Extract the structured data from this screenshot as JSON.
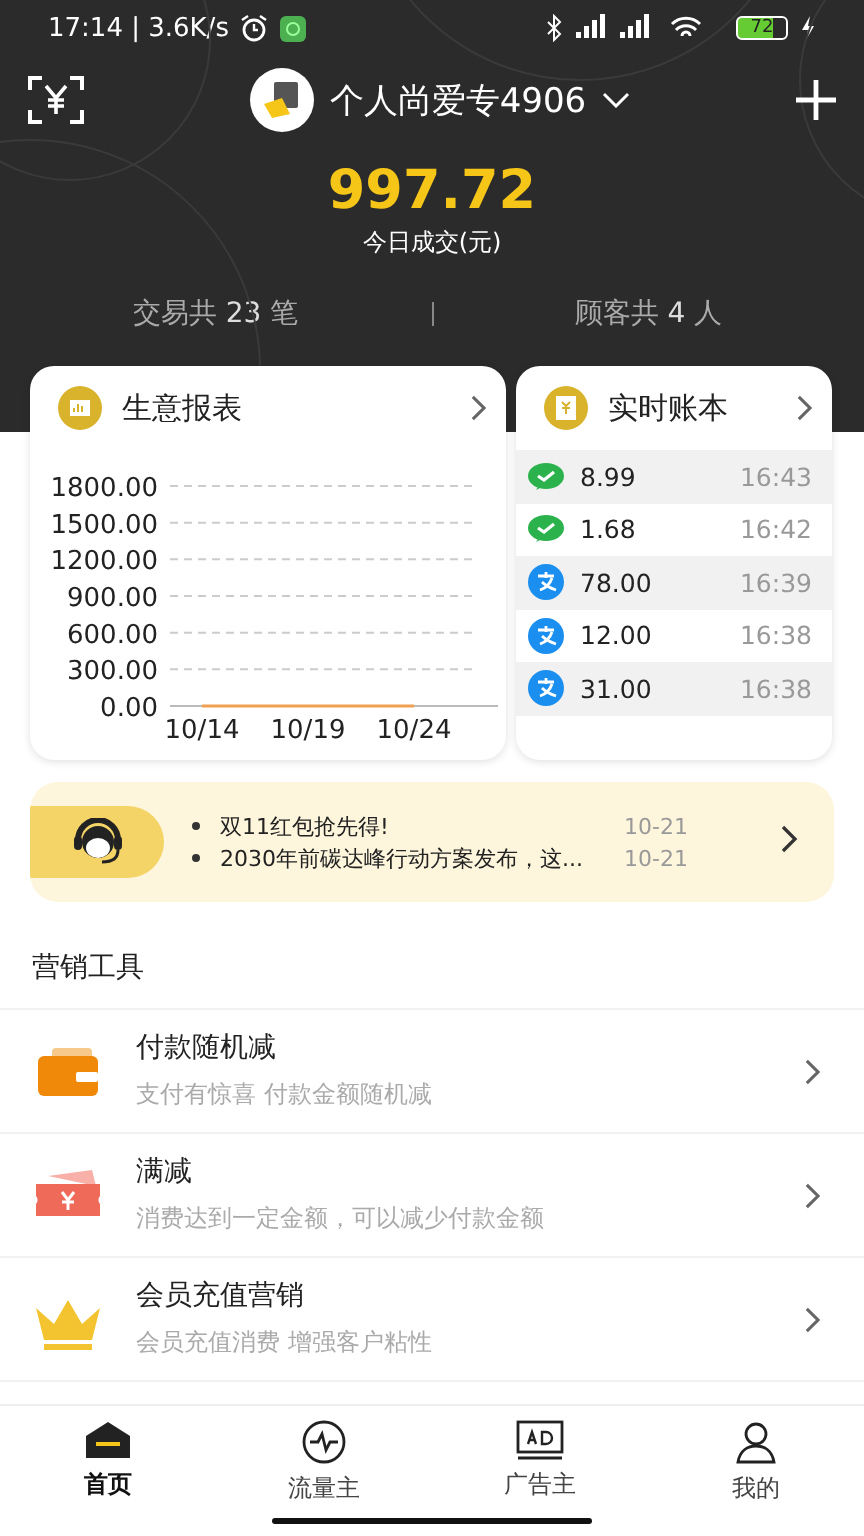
{
  "status_bar": {
    "time": "17:14 | 3.6K/s",
    "battery": "72"
  },
  "header": {
    "store_name": "个人尚爱专4906",
    "amount": "997.72",
    "amount_label": "今日成交(元)",
    "stats": [
      {
        "label": "交易共",
        "value": "23",
        "unit": "笔"
      },
      {
        "label": "顾客共",
        "value": "4",
        "unit": "人"
      }
    ]
  },
  "report_card": {
    "title": "生意报表",
    "chart_data": {
      "type": "line",
      "categories": [
        "10/14",
        "10/19",
        "10/24"
      ],
      "series": [
        {
          "color": "#f0a050",
          "values": [
            0,
            0,
            0
          ]
        }
      ],
      "ylim": [
        0,
        1800
      ],
      "grid": true,
      "yticks": [
        {
          "value": 0,
          "label": "0.00"
        },
        {
          "value": 300,
          "label": "300.00"
        },
        {
          "value": 600,
          "label": "600.00"
        },
        {
          "value": 900,
          "label": "900.00"
        },
        {
          "value": 1200,
          "label": "1200.00"
        },
        {
          "value": 1500,
          "label": "1500.00"
        },
        {
          "value": 1800,
          "label": "1800.00"
        }
      ]
    }
  },
  "ledger_card": {
    "title": "实时账本",
    "entries": [
      {
        "kind": "wechat",
        "amount": "8.99",
        "time": "16:43"
      },
      {
        "kind": "wechat",
        "amount": "1.68",
        "time": "16:42"
      },
      {
        "kind": "alipay",
        "amount": "78.00",
        "time": "16:39"
      },
      {
        "kind": "alipay",
        "amount": "12.00",
        "time": "16:38"
      },
      {
        "kind": "alipay",
        "amount": "31.00",
        "time": "16:38"
      }
    ]
  },
  "news": [
    {
      "text": "双11红包抢先得!",
      "date": "10-21"
    },
    {
      "text": "2030年前碳达峰行动方案发布，这...",
      "date": "10-21"
    }
  ],
  "section_title": "营销工具",
  "tools": [
    {
      "kind": "wallet",
      "title": "付款随机减",
      "subtitle": "支付有惊喜 付款金额随机减"
    },
    {
      "kind": "ticket",
      "title": "满减",
      "subtitle": "消费达到一定金额，可以减少付款金额"
    },
    {
      "kind": "crown",
      "title": "会员充值营销",
      "subtitle": "会员充值消费 增强客户粘性"
    }
  ],
  "tabs": [
    {
      "kind": "home",
      "label": "首页",
      "selected": true
    },
    {
      "kind": "traffic",
      "label": "流量主",
      "selected": false
    },
    {
      "kind": "ad",
      "label": "广告主",
      "selected": false
    },
    {
      "kind": "user",
      "label": "我的",
      "selected": false
    }
  ]
}
